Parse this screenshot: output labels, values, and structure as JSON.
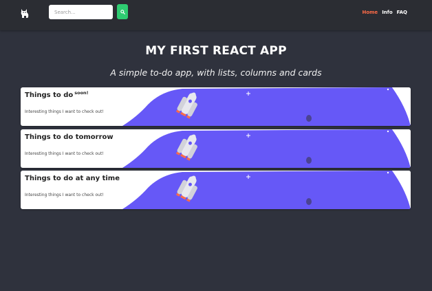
{
  "nav": {
    "logo_icon": "cat-icon",
    "search_placeholder": "Search...",
    "search_icon": "search-icon",
    "links": [
      {
        "label": "Home",
        "active": true
      },
      {
        "label": "Info",
        "active": false
      },
      {
        "label": "FAQ",
        "active": false
      }
    ]
  },
  "header": {
    "title": "MY FIRST REACT APP",
    "subtitle": "A simple to-do app, with lists, columns and cards"
  },
  "lists": [
    {
      "title": "Things to do",
      "badge": "soon!",
      "description": "Interesting things I want to check out!"
    },
    {
      "title": "Things to do tomorrow",
      "badge": "",
      "description": "Interesting things I want to check out!"
    },
    {
      "title": "Things to do at any time",
      "badge": "",
      "description": "Interesting things I want to check out!"
    }
  ],
  "colors": {
    "background": "#2f323d",
    "navbar": "#2b2d33",
    "accent_purple": "#6658f7",
    "active_link": "#ff6b47",
    "search_button": "#2ecc71"
  }
}
